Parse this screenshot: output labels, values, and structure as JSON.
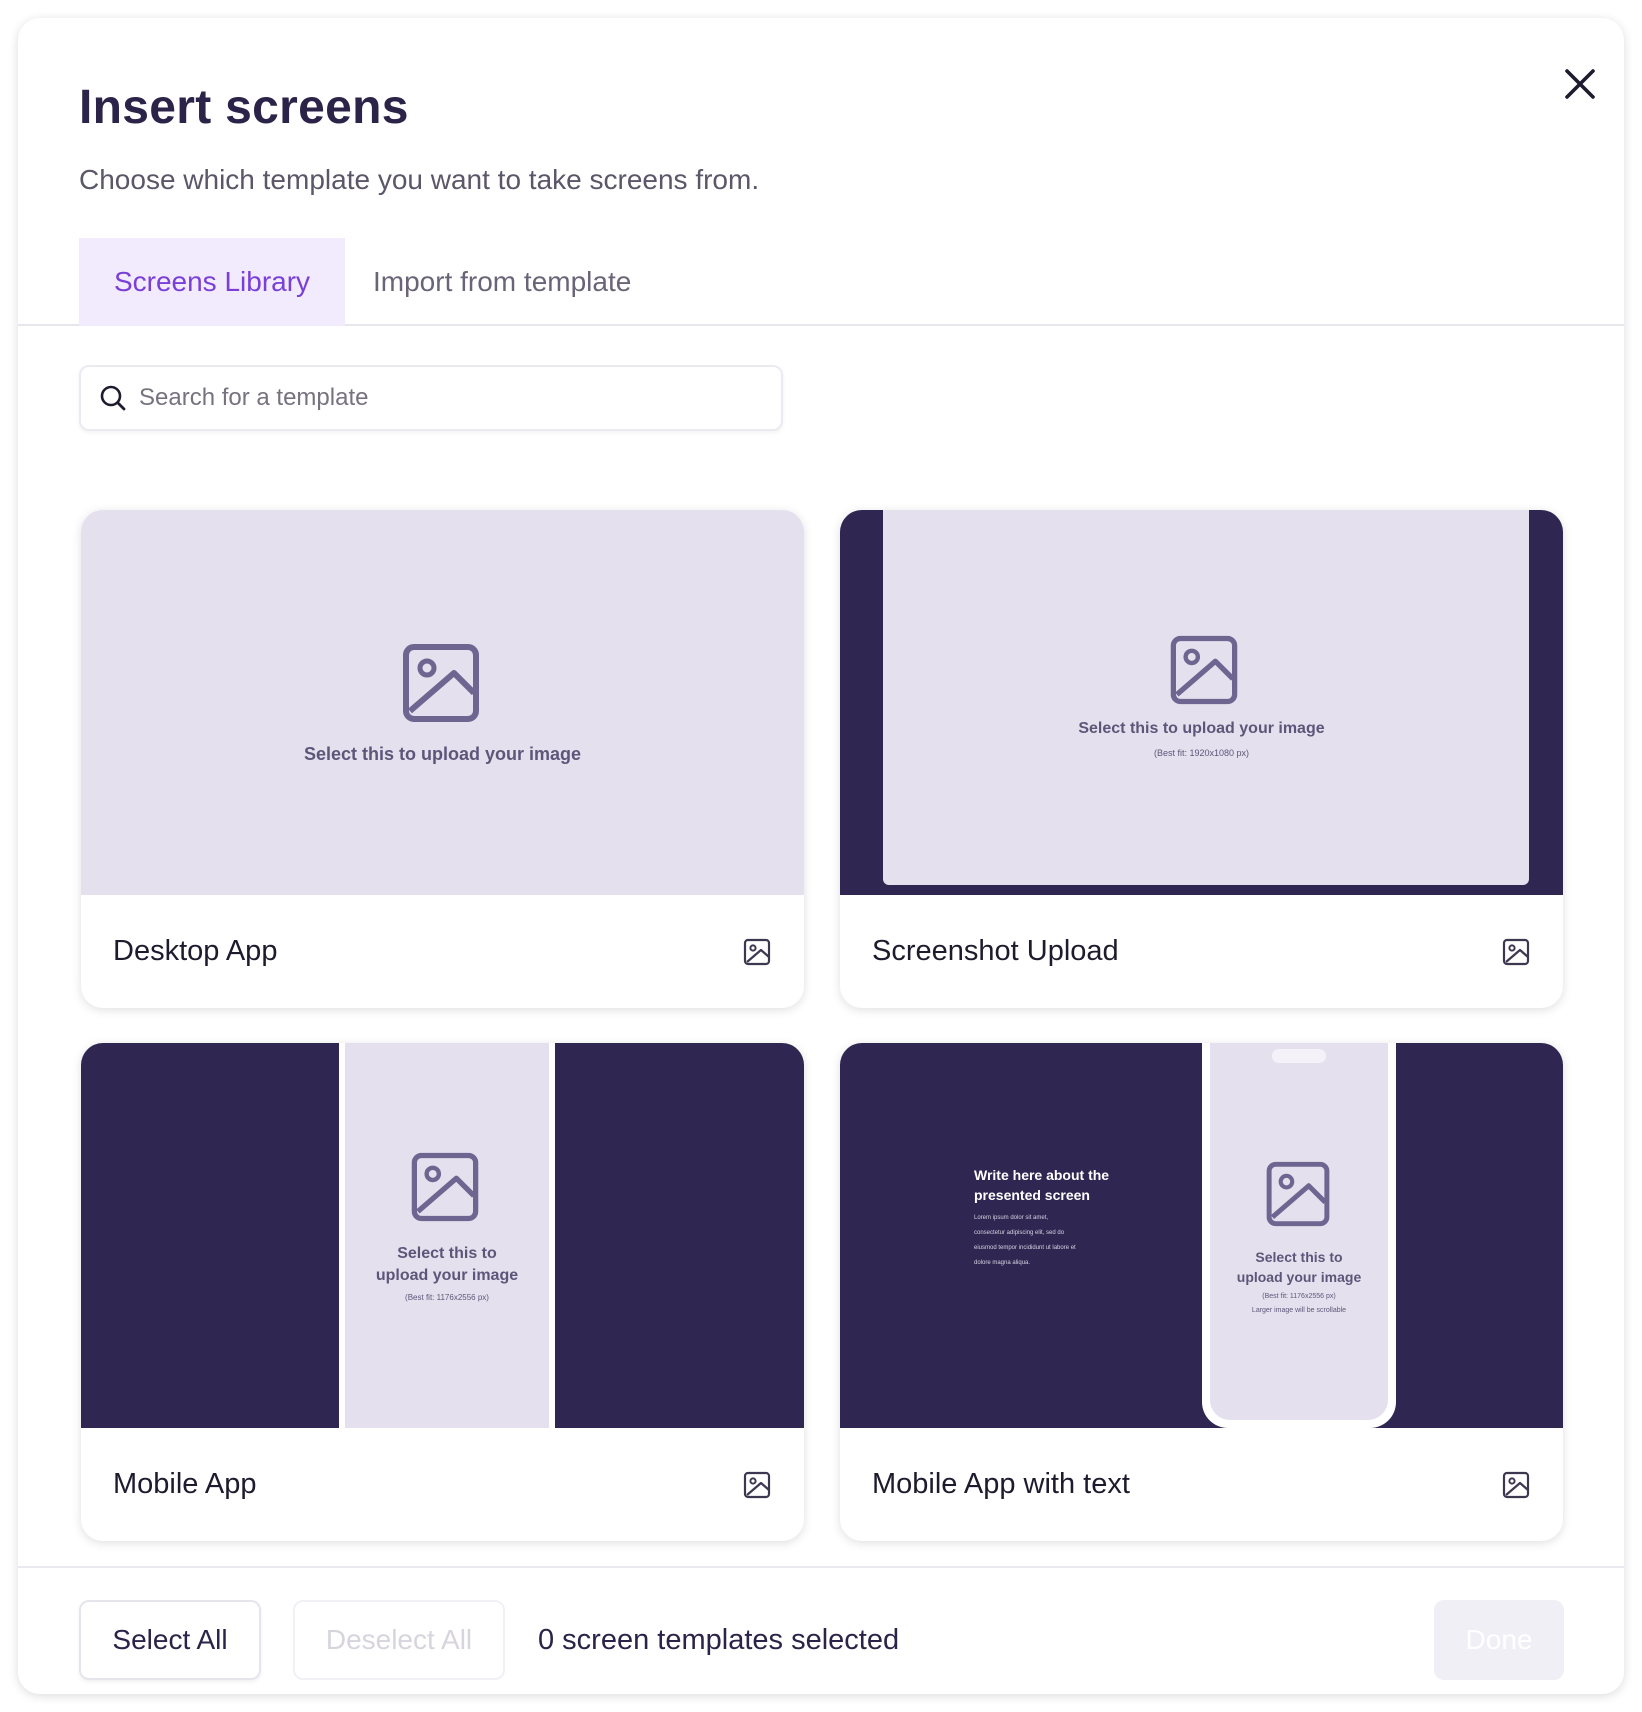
{
  "dialog": {
    "title": "Insert screens",
    "subtitle": "Choose which template you want to take screens from.",
    "close_icon": "close-icon"
  },
  "tabs": [
    {
      "label": "Screens Library",
      "active": true
    },
    {
      "label": "Import from template",
      "active": false
    }
  ],
  "search": {
    "placeholder": "Search for a template",
    "value": "",
    "icon": "search-icon"
  },
  "templates": [
    {
      "name": "Desktop App",
      "icon": "image-icon",
      "preview": {
        "line1": "Select this to upload your image"
      }
    },
    {
      "name": "Screenshot Upload",
      "icon": "image-icon",
      "preview": {
        "line1": "Select this to upload your image",
        "line2": "(Best fit: 1920x1080 px)"
      }
    },
    {
      "name": "Mobile App",
      "icon": "image-icon",
      "preview": {
        "line1": "Select this to",
        "line2": "upload your image",
        "line3": "(Best fit: 1176x2556 px)"
      }
    },
    {
      "name": "Mobile App with text",
      "icon": "image-icon",
      "preview": {
        "heading1": "Write here about the",
        "heading2": "presented screen",
        "body1": "Lorem ipsum dolor sit amet,",
        "body2": "consectetur adipiscing elit, sed do",
        "body3": "eiusmod tempor incididunt ut labore et",
        "body4": "dolore magna aliqua.",
        "line1": "Select this to",
        "line2": "upload your image",
        "line3": "(Best fit: 1176x2556 px)",
        "line4": "Larger image will be scrollable"
      }
    }
  ],
  "footer": {
    "select_all": "Select All",
    "deselect_all": "Deselect All",
    "count_text": "0 screen templates selected",
    "done": "Done"
  },
  "colors": {
    "accent": "#7a3fd6",
    "tab_active_bg": "#f1ebfd",
    "dark_frame": "#2f2752",
    "placeholder_bg": "#e4e0ee",
    "placeholder_icon": "#6e6590"
  }
}
